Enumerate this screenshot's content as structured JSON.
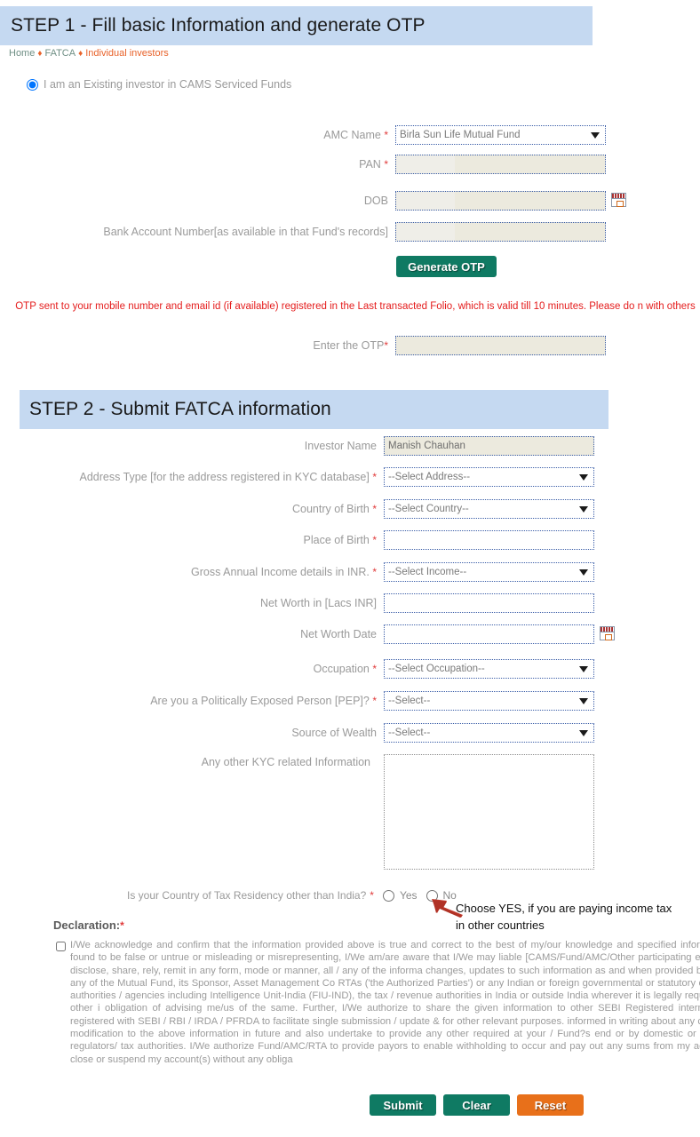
{
  "step1": {
    "banner_title": "STEP 1 - Fill basic Information and generate OTP",
    "breadcrumb": {
      "home": "Home",
      "section": "FATCA",
      "current": "Individual investors",
      "separator": "♦"
    },
    "existing_investor_label": "I am an Existing investor in CAMS Serviced Funds",
    "fields": {
      "amc_name": {
        "label": "AMC Name",
        "required": "*",
        "value": "Birla Sun Life Mutual Fund"
      },
      "pan": {
        "label": "PAN",
        "required": "*",
        "value": ""
      },
      "dob": {
        "label": "DOB",
        "required": "",
        "value": ""
      },
      "bank_account": {
        "label": "Bank Account Number[as available in that Fund's records]",
        "required": "",
        "value": ""
      },
      "otp": {
        "label": "Enter the OTP",
        "required": "*",
        "value": ""
      }
    },
    "generate_otp_label": "Generate OTP",
    "otp_notice": "OTP sent to your mobile number and email id (if available) registered in the Last transacted Folio, which is valid till 10 minutes. Please do n with others"
  },
  "step2": {
    "banner_title": "STEP 2 - Submit FATCA information",
    "fields": {
      "investor_name": {
        "label": "Investor Name",
        "required": "",
        "value": "Manish Chauhan"
      },
      "address_type": {
        "label": "Address Type [for the address registered in KYC database]",
        "required": "*",
        "value": "--Select Address--"
      },
      "country_of_birth": {
        "label": "Country of Birth",
        "required": "*",
        "value": "--Select Country--"
      },
      "place_of_birth": {
        "label": "Place of Birth",
        "required": "*",
        "value": ""
      },
      "gross_annual_income": {
        "label": "Gross Annual Income details in INR.",
        "required": "*",
        "value": "--Select Income--"
      },
      "net_worth": {
        "label": "Net Worth in [Lacs INR]",
        "required": "",
        "value": ""
      },
      "net_worth_date": {
        "label": "Net Worth Date",
        "required": "",
        "value": ""
      },
      "occupation": {
        "label": "Occupation",
        "required": "*",
        "value": "--Select Occupation--"
      },
      "pep": {
        "label": "Are you a Politically Exposed Person [PEP]?",
        "required": "*",
        "value": "--Select--"
      },
      "source_of_wealth": {
        "label": "Source of Wealth",
        "required": "",
        "value": "--Select--"
      },
      "other_kyc_info": {
        "label": "Any other KYC related Information",
        "required": "",
        "value": ""
      }
    },
    "tax_residency": {
      "label": "Is your Country of Tax Residency other than India?",
      "required": "*",
      "option_yes": "Yes",
      "option_no": "No"
    },
    "annotation_note": "Choose YES, if you are paying income tax in other countries",
    "declaration": {
      "heading": "Declaration:",
      "required": "*",
      "text": "I/We acknowledge and confirm that the information provided above is true and correct to the best of my/our knowledge and specified information is found to be false or untrue or misleading or misrepresenting, I/We am/are aware that I/We may liable [CAMS/Fund/AMC/Other participating entities] to disclose, share, rely, remit in any form, mode or manner, all / any of the informa changes, updates to such information as and when provided by me to / any of the Mutual Fund, its Sponsor, Asset Management Co RTAs ('the Authorized Parties') or any Indian or foreign governmental or statutory or judicial authorities / agencies including Intelligence Unit-India (FIU-IND), the tax / revenue authorities in India or outside India wherever it is legally required and other i obligation of advising me/us of the same. Further, I/We authorize to share the given information to other SEBI Registered intermediaries registered with SEBI / RBI / IRDA / PFRDA to facilitate single submission / update & for other relevant purposes. informed in writing about any changes / modification to the above information in future and also undertake to provide any other required at your / Fund?s end or by domestic or overseas regulators/ tax authorities. I/We authorize Fund/AMC/RTA to provide payors to enable withholding to occur and pay out any sums from my account or close or suspend my account(s) without any obliga"
    }
  },
  "buttons": {
    "submit": "Submit",
    "clear": "Clear",
    "reset": "Reset"
  },
  "colors": {
    "banner_blue": "#c5d9f1",
    "teal_button": "#0f7a63",
    "orange_button": "#e8701a",
    "notice_red": "#e41b1b",
    "required_red": "#e03a3a",
    "field_fill": "#eceade",
    "field_border": "#3b5ea8"
  }
}
